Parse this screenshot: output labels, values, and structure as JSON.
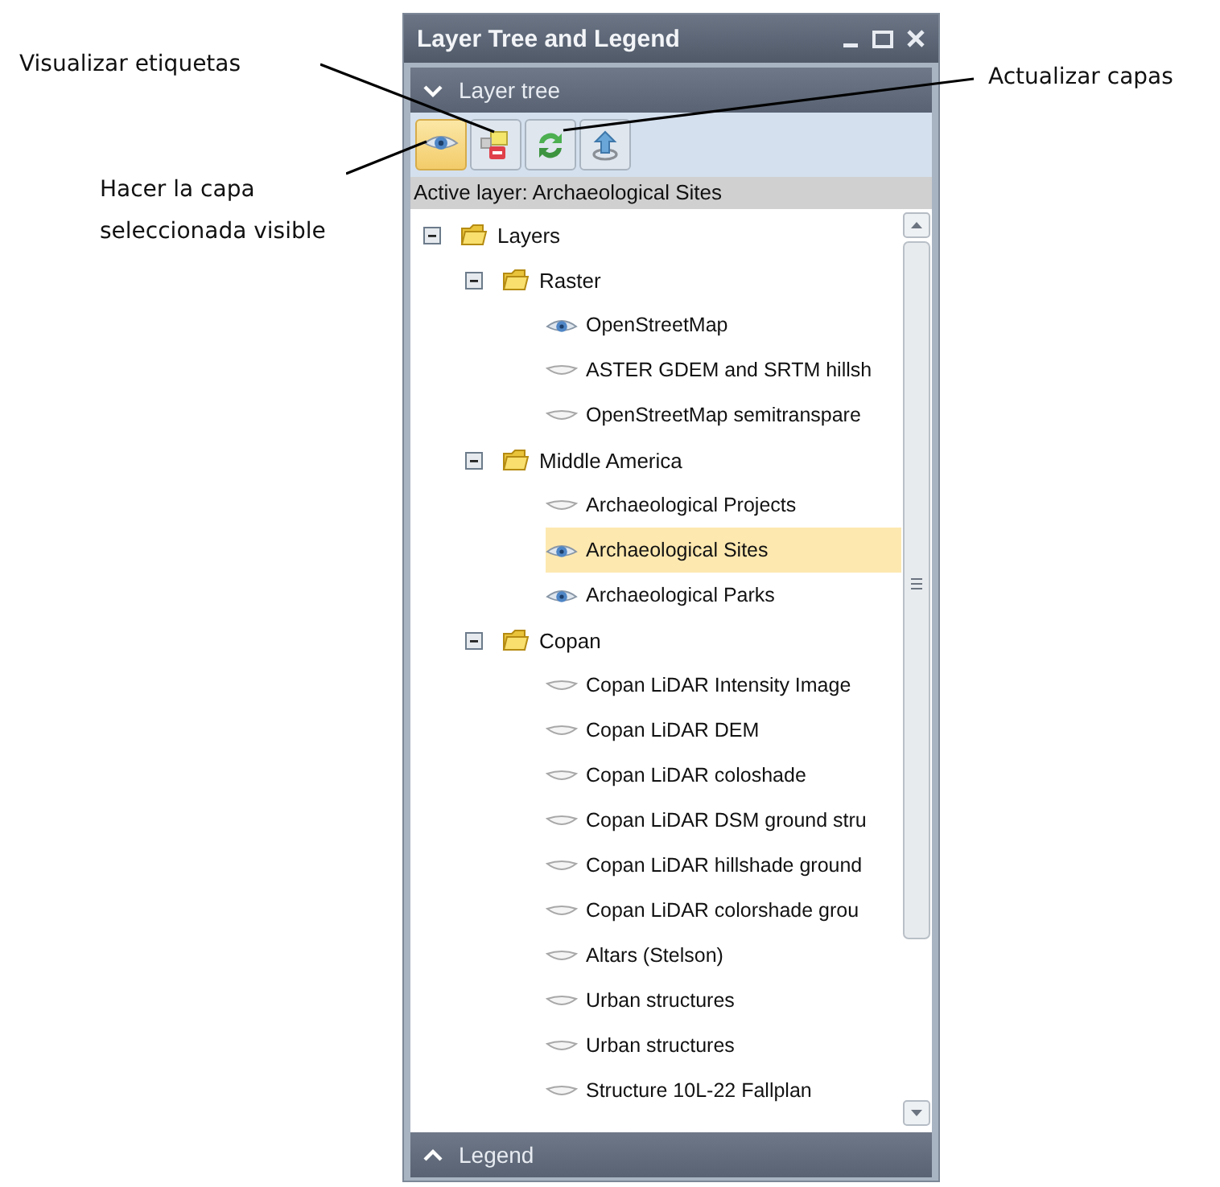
{
  "annotations": [
    {
      "text": "Visualizar etiquetas",
      "kind": "labels"
    },
    {
      "text": "Hacer la capa seleccionada visible",
      "kind": "visible"
    },
    {
      "text": "Actualizar capas",
      "kind": "refresh"
    }
  ],
  "window": {
    "title": "Layer Tree and Legend"
  },
  "layer_tree": {
    "title": "Layer tree",
    "expanded": true,
    "toolbar": [
      {
        "kind": "eye",
        "pressed": true
      },
      {
        "kind": "labels",
        "pressed": false
      },
      {
        "kind": "refresh",
        "pressed": false
      },
      {
        "kind": "upload",
        "pressed": false
      }
    ],
    "active_layer": "Active layer: Archaeological Sites",
    "tree": [
      {
        "label": "Layers",
        "expanded": true,
        "children": [
          {
            "label": "Raster",
            "expanded": true,
            "children": [
              {
                "label": "OpenStreetMap",
                "visible": true,
                "selected": false
              },
              {
                "label": "ASTER GDEM and SRTM hillsh",
                "visible": false,
                "selected": false
              },
              {
                "label": "OpenStreetMap semitranspare",
                "visible": false,
                "selected": false
              }
            ]
          },
          {
            "label": "Middle America",
            "expanded": true,
            "children": [
              {
                "label": "Archaeological Projects",
                "visible": false,
                "selected": false
              },
              {
                "label": "Archaeological Sites",
                "visible": true,
                "selected": true
              },
              {
                "label": "Archaeological Parks",
                "visible": true,
                "selected": false
              }
            ]
          },
          {
            "label": "Copan",
            "expanded": true,
            "children": [
              {
                "label": "Copan LiDAR Intensity Image",
                "visible": false,
                "selected": false
              },
              {
                "label": "Copan LiDAR DEM",
                "visible": false,
                "selected": false
              },
              {
                "label": "Copan LiDAR coloshade",
                "visible": false,
                "selected": false
              },
              {
                "label": "Copan LiDAR DSM ground stru",
                "visible": false,
                "selected": false
              },
              {
                "label": "Copan LiDAR hillshade ground",
                "visible": false,
                "selected": false
              },
              {
                "label": "Copan LiDAR colorshade grou",
                "visible": false,
                "selected": false
              },
              {
                "label": "Altars (Stelson)",
                "visible": false,
                "selected": false
              },
              {
                "label": "Urban structures",
                "visible": false,
                "selected": false
              },
              {
                "label": "Urban structures",
                "visible": false,
                "selected": false
              },
              {
                "label": "Structure 10L-22 Fallplan",
                "visible": false,
                "selected": false
              }
            ]
          }
        ]
      }
    ]
  },
  "legend": {
    "title": "Legend",
    "expanded": false
  }
}
